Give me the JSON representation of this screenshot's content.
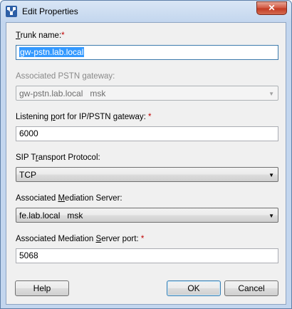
{
  "window": {
    "title": "Edit Properties",
    "close_glyph": "✕"
  },
  "fields": {
    "trunk_name": {
      "label_pre": "",
      "label_key": "T",
      "label_post": "runk name:",
      "required": "*",
      "value": "gw-pstn.lab.local"
    },
    "pstn_gateway": {
      "label": "Associated PSTN gateway:",
      "value_host": "gw-pstn.lab.local",
      "value_site": "msk"
    },
    "listening_port": {
      "label_pre": "Listening ",
      "label_key": "p",
      "label_post": "ort for IP/PSTN gateway:",
      "required": "*",
      "value": "6000"
    },
    "sip_transport": {
      "label_pre": "SIP T",
      "label_key": "r",
      "label_post": "ansport Protocol:",
      "value": "TCP"
    },
    "mediation_server": {
      "label_pre": "Associated ",
      "label_key": "M",
      "label_post": "ediation Server:",
      "value_host": "fe.lab.local",
      "value_site": "msk"
    },
    "mediation_port": {
      "label_pre": "Associated Mediation ",
      "label_key": "S",
      "label_post": "erver port:",
      "required": "*",
      "value": "5068"
    }
  },
  "buttons": {
    "help": "Help",
    "ok": "OK",
    "cancel": "Cancel"
  },
  "icons": {
    "app": "properties-icon",
    "dropdown": "chevron-down-icon"
  }
}
